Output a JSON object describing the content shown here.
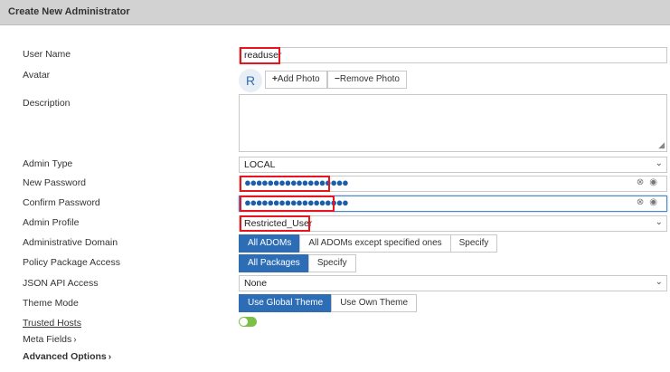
{
  "title": "Create New Administrator",
  "labels": {
    "user_name": "User Name",
    "avatar": "Avatar",
    "description": "Description",
    "admin_type": "Admin Type",
    "new_password": "New Password",
    "confirm_password": "Confirm Password",
    "admin_profile": "Admin Profile",
    "administrative_domain": "Administrative Domain",
    "policy_package_access": "Policy Package Access",
    "json_api_access": "JSON API Access",
    "theme_mode": "Theme Mode",
    "trusted_hosts": "Trusted Hosts",
    "meta_fields": "Meta Fields",
    "advanced_options": "Advanced Options"
  },
  "fields": {
    "user_name": "readuser",
    "avatar_initial": "R",
    "add_photo": "Add Photo",
    "remove_photo": "Remove Photo",
    "description": "",
    "admin_type": "LOCAL",
    "new_password_mask": "●●●●●●●●●●●●●●●●●●",
    "confirm_password_mask": "●●●●●●●●●●●●●●●●●●",
    "admin_profile": "Restricted_User",
    "json_api_access": "None"
  },
  "adom_options": [
    "All ADOMs",
    "All ADOMs except specified ones",
    "Specify"
  ],
  "adom_selected": "All ADOMs",
  "package_options": [
    "All Packages",
    "Specify"
  ],
  "package_selected": "All Packages",
  "theme_options": [
    "Use Global Theme",
    "Use Own Theme"
  ],
  "theme_selected": "Use Global Theme",
  "trusted_hosts_enabled": true,
  "colors": {
    "accent": "#2d6db5",
    "highlight": "#e8141e",
    "toggle_on": "#7cc04a"
  }
}
